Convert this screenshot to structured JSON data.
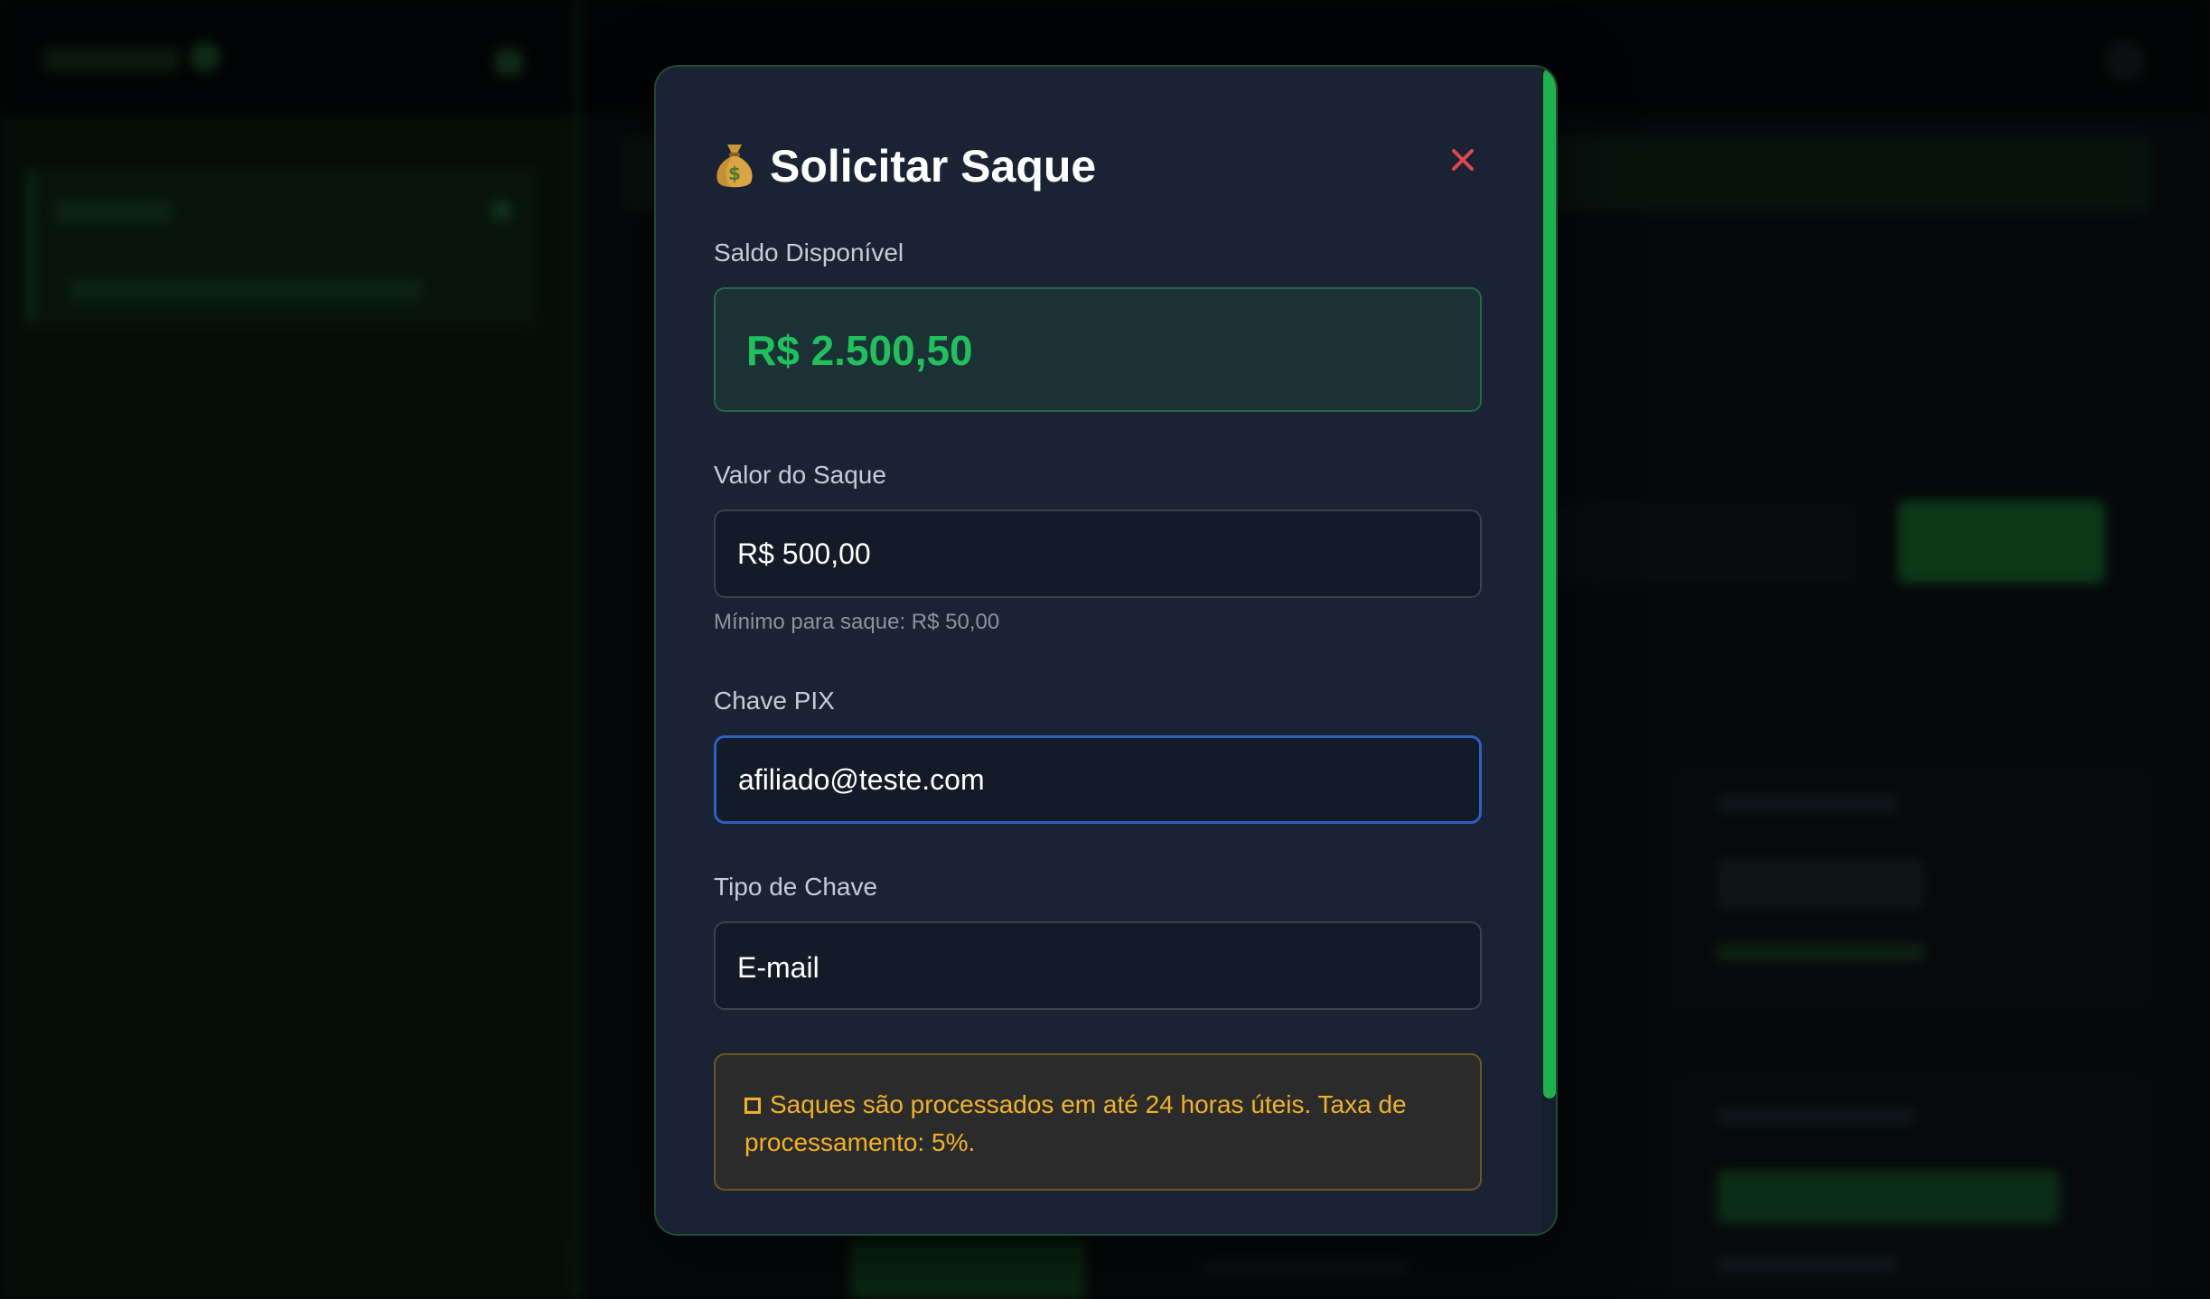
{
  "modal": {
    "title": "Solicitar Saque",
    "title_icon": "money-bag-icon",
    "close_icon": "close-icon",
    "balance": {
      "label": "Saldo Disponível",
      "value": "R$ 2.500,50"
    },
    "amount": {
      "label": "Valor do Saque",
      "value": "R$ 500,00",
      "helper": "Mínimo para saque: R$ 50,00"
    },
    "pix_key": {
      "label": "Chave PIX",
      "value": "afiliado@teste.com"
    },
    "key_type": {
      "label": "Tipo de Chave",
      "value": "E-mail"
    },
    "notice": {
      "icon": "checkbox-icon",
      "text": "Saques são processados em até 24 horas úteis. Taxa de processamento: 5%."
    }
  },
  "colors": {
    "modal_background": "#1a2333",
    "accent_green": "#1fc15c",
    "close_red": "#e0484e",
    "notice_yellow": "#f0b323",
    "focus_blue": "#2f5fbf"
  }
}
